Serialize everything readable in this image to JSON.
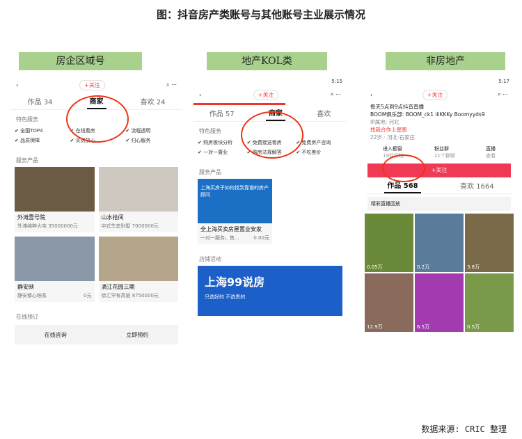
{
  "title": "图：抖音房产类账号与其他账号主业展示情况",
  "labels": [
    "房企区域号",
    "地产KOL类",
    "非房地产"
  ],
  "p1": {
    "follow": "+关注",
    "tabs": [
      "作品 34",
      "商家",
      "喜欢 24"
    ],
    "feature": "特色服务",
    "chips": [
      "全国TOP4",
      "在线看房",
      "流程透明",
      "品质保障",
      "买房放心",
      "归心服务"
    ],
    "svc": "服务产品",
    "cards": [
      {
        "n": "外滩壹号院",
        "d": "外滩纯粹大宅 35000000元"
      },
      {
        "n": "山水拾间",
        "d": "中式生态别墅 7000000元"
      },
      {
        "n": "静安映",
        "d": "静安都心映系",
        "p": "0元"
      },
      {
        "n": "滴江花园三期",
        "d": "徐汇罕有高层 8750000元"
      }
    ],
    "online": "在线预订",
    "btn1": "在线咨询",
    "btn2": "立即预约"
  },
  "p2": {
    "time": "5:15",
    "follow": "+关注",
    "tabs": [
      "作品 57",
      "商家",
      "喜欢"
    ],
    "feature": "特色服务",
    "chips": [
      "购房板块分析",
      "免费接送看房",
      "免费房产咨询",
      "一对一置业",
      "购房法规解答",
      "不吃差价"
    ],
    "svc": "服务产品",
    "card": {
      "n": "全上海买卖房屋置业安家",
      "d": "一对一服务，售...",
      "p": "0.00元"
    },
    "img_text": "上海买房子如何找到靠谱的房产顾问",
    "act": "店铺活动",
    "banner": "上海99说房",
    "b1": "只选好的",
    "b2": "不选贵的"
  },
  "p3": {
    "time": "5:17",
    "follow": "+关注",
    "bio1": "每天5点到9点抖音直播",
    "bio2": "BOOM俱乐部: BOOM_ck1 iiiKKKy Boomyyds9",
    "ip": "IP属地: 河北",
    "coop": "找我合作上星图",
    "stats": "22岁 · 河北·石家庄",
    "shop": "进入橱窗",
    "shop_sub": "19件好物",
    "fans": "粉丝群",
    "fans_sub": "21个群聊",
    "live": "直播",
    "live_sub": "查看",
    "follow_btn": "+关注",
    "tabs": [
      "作品 568",
      "喜欢 1664"
    ],
    "replay": "精彩直播回放",
    "views": [
      "0.05万",
      "0.2万",
      "3.8万",
      "12.9万",
      "6.5万",
      "0.5万"
    ]
  },
  "source": "数据来源: CRIC 整理"
}
